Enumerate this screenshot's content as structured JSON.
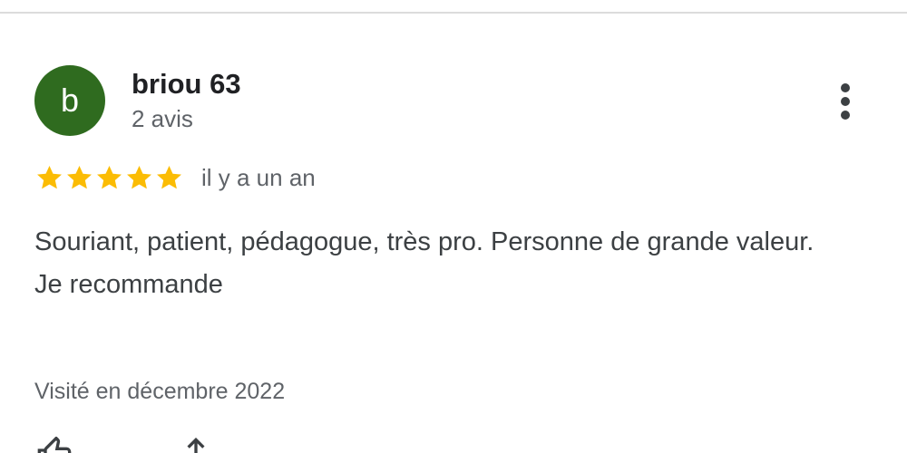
{
  "reviewer": {
    "avatar_initial": "b",
    "name": "briou 63",
    "review_count": "2 avis"
  },
  "review": {
    "rating": 5,
    "rating_max": 5,
    "date": "il y a un an",
    "text_line_1": "Souriant, patient, pédagogue, très pro. Personne de grande valeur.",
    "text_line_2": "Je recommande",
    "visit": "Visité en décembre 2022"
  },
  "icons": {
    "more": "more-vert-icon",
    "star": "star-icon",
    "like": "thumb-up-icon",
    "share": "share-icon"
  },
  "colors": {
    "avatar_background": "#2f6b1f",
    "star": "#fbbc04",
    "name_text": "#202124",
    "secondary_text": "#5f6368",
    "body_text": "#3c4043"
  }
}
